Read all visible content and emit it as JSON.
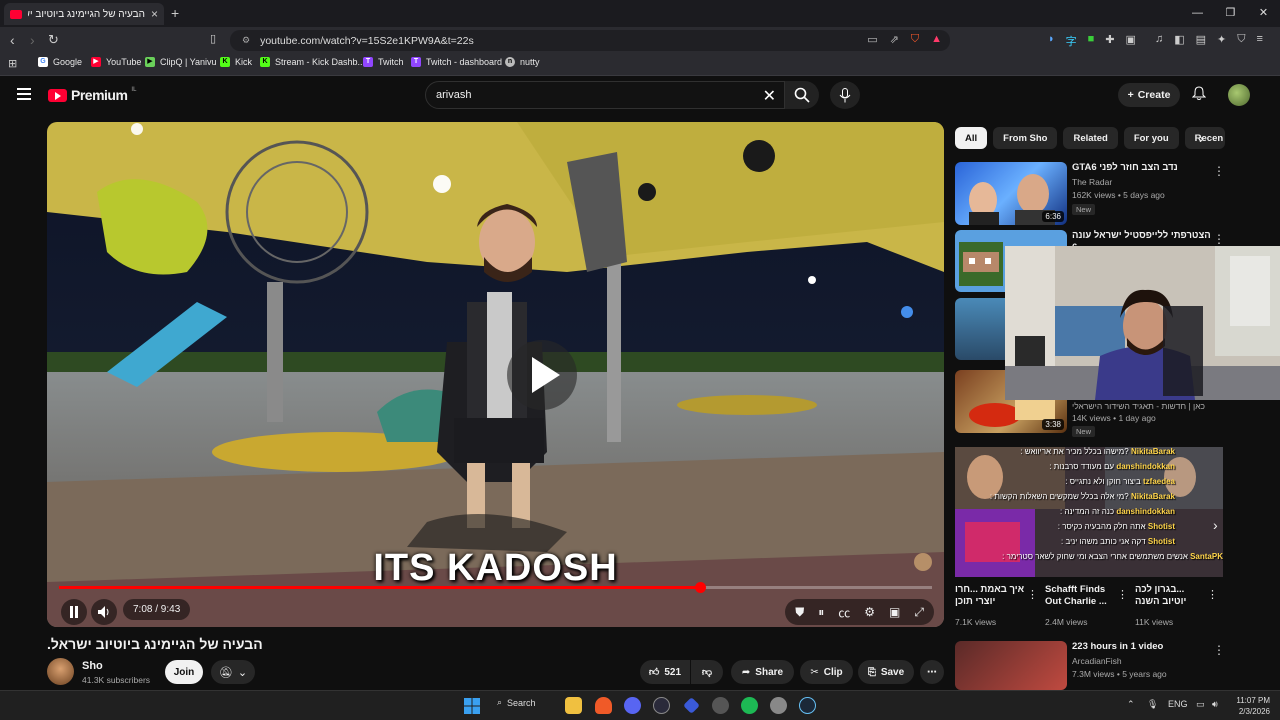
{
  "browser": {
    "tab_title": "הבעיה של הגיימינג ביוטיוב ישר",
    "tab_close": "×",
    "new_tab": "+",
    "url": "youtube.com/watch?v=15S2e1KPW9A&t=22s",
    "bookmarks": [
      {
        "label": "Google",
        "color": "#4285f4",
        "glyph": "G"
      },
      {
        "label": "YouTube",
        "color": "#ff0033",
        "glyph": "▶"
      },
      {
        "label": "ClipQ | Yanivu",
        "color": "#6ad05a",
        "glyph": "▶"
      },
      {
        "label": "Kick",
        "color": "#53fc18",
        "glyph": "K"
      },
      {
        "label": "Stream - Kick Dashb...",
        "color": "#53fc18",
        "glyph": "K"
      },
      {
        "label": "Twitch",
        "color": "#9146ff",
        "glyph": "T"
      },
      {
        "label": "Twitch - dashboard",
        "color": "#9146ff",
        "glyph": "T"
      },
      {
        "label": "nutty",
        "color": "#bbbbbb",
        "glyph": "n"
      }
    ]
  },
  "youtube": {
    "brand": "Premium",
    "brand_region": "IL",
    "search_query": "arivash",
    "create_label": "Create"
  },
  "video": {
    "subtitle": "ITS KADOSH",
    "time": "7:08 / 9:43",
    "progress_fraction": 0.734,
    "title": "הבעיה של הגיימינג ביוטיוב ישראל.",
    "channel_name": "Sho",
    "subscribers": "41.3K subscribers",
    "join_label": "Join",
    "like_count": "521",
    "share_label": "Share",
    "clip_label": "Clip",
    "save_label": "Save"
  },
  "chips": [
    "All",
    "From Sho",
    "Related",
    "For you",
    "Recen"
  ],
  "sidebar": [
    {
      "title": "נדב הצב חוזר לפני GTA6",
      "channel": "The Radar",
      "meta": "162K views • 5 days ago",
      "badge": "New",
      "duration": "6:36"
    },
    {
      "title": "הצטרפתי ללייפסטיל ישראל עונה 6",
      "channel": "",
      "meta": "",
      "badge": "",
      "duration": ""
    },
    {
      "title": "כאן | חדשות - תאגיד השידור הישראלי",
      "channel": "",
      "meta": "14K views • 1 day ago",
      "badge": "New",
      "duration": "3:38"
    }
  ],
  "chat": [
    {
      "user": "NikitaBarak",
      "msg": ": מישהו בכלל מכיר את אריוואש?"
    },
    {
      "user": "danshindokkan",
      "msg": ": עם מעודד סרבנות"
    },
    {
      "user": "tzfaedea",
      "msg": ": ביצור חוקן ולא נתגייס"
    },
    {
      "user": "NikitaBarak",
      "msg": ": מי אלה בכלל שמקשים השאלות הקשות?"
    },
    {
      "user": "danshindokkan",
      "msg": ": כנה זה המדינה"
    },
    {
      "user": "Shotist",
      "msg": ": אתה חלק מהבעיה כקיסר"
    },
    {
      "user": "Shotist",
      "msg": ": דקה אני כותב משהו יניב"
    },
    {
      "user": "SantaPK",
      "msg": ": אנשים משתמשים אחרי הצבא ומי שחוק לשאר סטרימר"
    }
  ],
  "bottom_grid": [
    {
      "title": "איך באמת ...חרו יוצרי תוכן",
      "views": "7.1K views"
    },
    {
      "title": "Schafft Finds Out Charlie ...",
      "views": "2.4M views"
    },
    {
      "title": "...בגרון לכה יוטיוב השנה",
      "views": "11K views"
    }
  ],
  "bottom_item": {
    "title": "223 hours in 1 video",
    "channel": "ArcadianFish",
    "meta": "7.3M views • 5 years ago"
  },
  "taskbar": {
    "search_label": "Search",
    "lang": "ENG",
    "time": "11:07 PM",
    "date": "2/3/2026"
  }
}
